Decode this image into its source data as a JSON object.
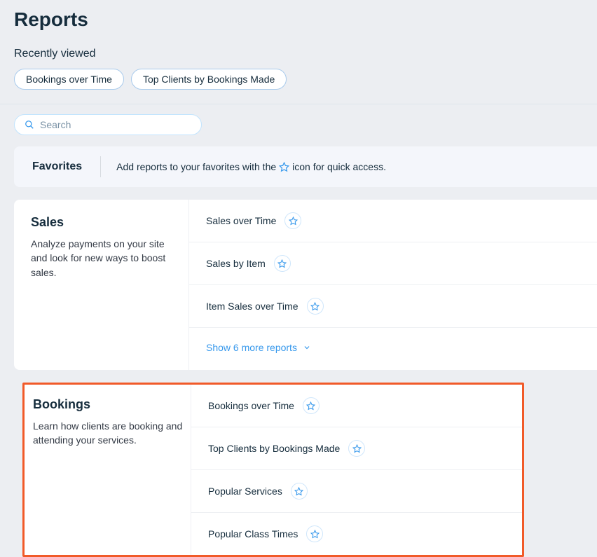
{
  "title": "Reports",
  "recent": {
    "label": "Recently viewed",
    "items": [
      "Bookings over Time",
      "Top Clients by Bookings Made"
    ]
  },
  "search": {
    "placeholder": "Search"
  },
  "favorites": {
    "title": "Favorites",
    "hint_pre": "Add reports to your favorites with the",
    "hint_post": "icon for quick access."
  },
  "sections": [
    {
      "title": "Sales",
      "desc": "Analyze payments on your site and look for new ways to boost sales.",
      "reports": [
        "Sales over Time",
        "Sales by Item",
        "Item Sales over Time"
      ],
      "show_more": "Show 6 more reports"
    },
    {
      "title": "Bookings",
      "desc": "Learn how clients are booking and attending your services.",
      "reports": [
        "Bookings over Time",
        "Top Clients by Bookings Made",
        "Popular Services",
        "Popular Class Times"
      ]
    }
  ]
}
